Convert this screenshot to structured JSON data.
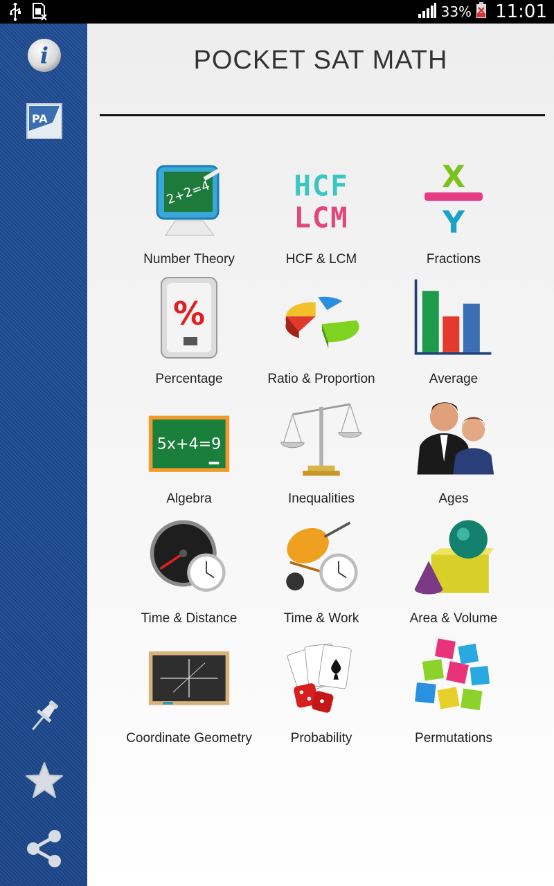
{
  "status_bar": {
    "signal_icon": "signal-bars-icon",
    "battery_percent": "33%",
    "time": "11:01"
  },
  "sidebar": {
    "items": [
      {
        "name": "info",
        "icon": "info-icon"
      },
      {
        "name": "pa",
        "icon": "pa-app-icon",
        "text": "PA"
      },
      {
        "name": "pin",
        "icon": "pin-icon"
      },
      {
        "name": "favorite",
        "icon": "star-icon"
      },
      {
        "name": "share",
        "icon": "share-icon"
      }
    ]
  },
  "header": {
    "title": "POCKET SAT MATH"
  },
  "topics": [
    {
      "label": "Number Theory",
      "icon": "chalkboard-monitor-icon"
    },
    {
      "label": "HCF & LCM",
      "icon": "hcf-lcm-blocks-icon"
    },
    {
      "label": "Fractions",
      "icon": "fraction-xy-icon"
    },
    {
      "label": "Percentage",
      "icon": "percent-tag-icon"
    },
    {
      "label": "Ratio & Proportion",
      "icon": "pie-chart-icon"
    },
    {
      "label": "Average",
      "icon": "bar-chart-icon"
    },
    {
      "label": "Algebra",
      "icon": "algebra-board-icon"
    },
    {
      "label": "Inequalities",
      "icon": "balance-scale-icon"
    },
    {
      "label": "Ages",
      "icon": "people-icon"
    },
    {
      "label": "Time & Distance",
      "icon": "speedometer-clock-icon"
    },
    {
      "label": "Time & Work",
      "icon": "cement-mixer-clock-icon"
    },
    {
      "label": "Area & Volume",
      "icon": "3d-shapes-icon"
    },
    {
      "label": "Coordinate Geometry",
      "icon": "coordinate-board-icon"
    },
    {
      "label": "Probability",
      "icon": "cards-dice-icon"
    },
    {
      "label": "Permutations",
      "icon": "letter-cubes-icon"
    }
  ],
  "icon_text": {
    "algebra": "5x+4=9",
    "number_theory": "2+2=4",
    "percent": "%",
    "hcf": "HCF",
    "lcm": "LCM",
    "x": "X",
    "y": "Y"
  }
}
